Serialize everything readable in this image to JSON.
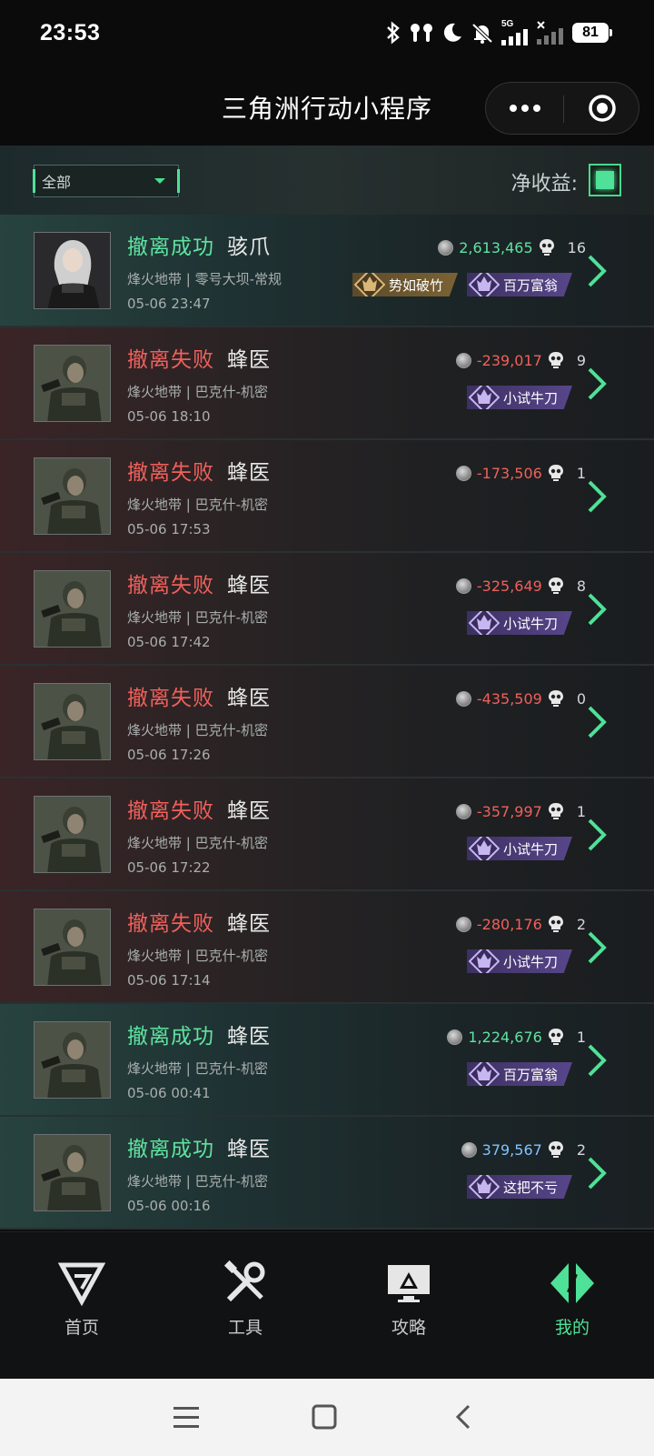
{
  "status_bar": {
    "time": "23:53",
    "battery": "81",
    "network": "5G",
    "icons": [
      "bluetooth-icon",
      "earbuds-icon",
      "moon-icon",
      "bell-off-icon",
      "signal-icon",
      "signal-x-icon",
      "battery-icon"
    ]
  },
  "title_bar": {
    "title": "三角洲行动小程序",
    "icons": [
      "more-dots-icon",
      "target-close-icon"
    ]
  },
  "filter": {
    "selected": "全部",
    "net_label": "净收益:",
    "net_enabled": true
  },
  "records": [
    {
      "result": "撤离成功",
      "status": "success",
      "operator": "骇爪",
      "map": "烽火地带 | 零号大坝-常规",
      "time": "05-06 23:47",
      "amount": "2,613,465",
      "amount_type": "pos",
      "kills": "16",
      "badges": [
        {
          "label": "势如破竹",
          "style": "gold"
        },
        {
          "label": "百万富翁",
          "style": "purple"
        }
      ]
    },
    {
      "result": "撤离失败",
      "status": "fail",
      "operator": "蜂医",
      "map": "烽火地带 | 巴克什-机密",
      "time": "05-06 18:10",
      "amount": "-239,017",
      "amount_type": "neg",
      "kills": "9",
      "badges": [
        {
          "label": "小试牛刀",
          "style": "purple"
        }
      ]
    },
    {
      "result": "撤离失败",
      "status": "fail",
      "operator": "蜂医",
      "map": "烽火地带 | 巴克什-机密",
      "time": "05-06 17:53",
      "amount": "-173,506",
      "amount_type": "neg",
      "kills": "1",
      "badges": []
    },
    {
      "result": "撤离失败",
      "status": "fail",
      "operator": "蜂医",
      "map": "烽火地带 | 巴克什-机密",
      "time": "05-06 17:42",
      "amount": "-325,649",
      "amount_type": "neg",
      "kills": "8",
      "badges": [
        {
          "label": "小试牛刀",
          "style": "purple"
        }
      ]
    },
    {
      "result": "撤离失败",
      "status": "fail",
      "operator": "蜂医",
      "map": "烽火地带 | 巴克什-机密",
      "time": "05-06 17:26",
      "amount": "-435,509",
      "amount_type": "neg",
      "kills": "0",
      "badges": []
    },
    {
      "result": "撤离失败",
      "status": "fail",
      "operator": "蜂医",
      "map": "烽火地带 | 巴克什-机密",
      "time": "05-06 17:22",
      "amount": "-357,997",
      "amount_type": "neg",
      "kills": "1",
      "badges": [
        {
          "label": "小试牛刀",
          "style": "purple"
        }
      ]
    },
    {
      "result": "撤离失败",
      "status": "fail",
      "operator": "蜂医",
      "map": "烽火地带 | 巴克什-机密",
      "time": "05-06 17:14",
      "amount": "-280,176",
      "amount_type": "neg",
      "kills": "2",
      "badges": [
        {
          "label": "小试牛刀",
          "style": "purple"
        }
      ]
    },
    {
      "result": "撤离成功",
      "status": "success",
      "operator": "蜂医",
      "map": "烽火地带 | 巴克什-机密",
      "time": "05-06 00:41",
      "amount": "1,224,676",
      "amount_type": "pos",
      "kills": "1",
      "badges": [
        {
          "label": "百万富翁",
          "style": "purple"
        }
      ]
    },
    {
      "result": "撤离成功",
      "status": "success",
      "operator": "蜂医",
      "map": "烽火地带 | 巴克什-机密",
      "time": "05-06 00:16",
      "amount": "379,567",
      "amount_type": "mid",
      "kills": "2",
      "badges": [
        {
          "label": "这把不亏",
          "style": "purple"
        }
      ]
    }
  ],
  "tabs": [
    {
      "label": "首页",
      "icon": "home-logo-icon",
      "active": false
    },
    {
      "label": "工具",
      "icon": "tools-icon",
      "active": false
    },
    {
      "label": "攻略",
      "icon": "guide-monitor-icon",
      "active": false
    },
    {
      "label": "我的",
      "icon": "profile-logo-icon",
      "active": true
    }
  ],
  "colors": {
    "accent": "#4ee197",
    "success": "#5fe3a0",
    "fail": "#f0605b",
    "badge_purple": "#57468a",
    "badge_gold": "#7a6234"
  }
}
